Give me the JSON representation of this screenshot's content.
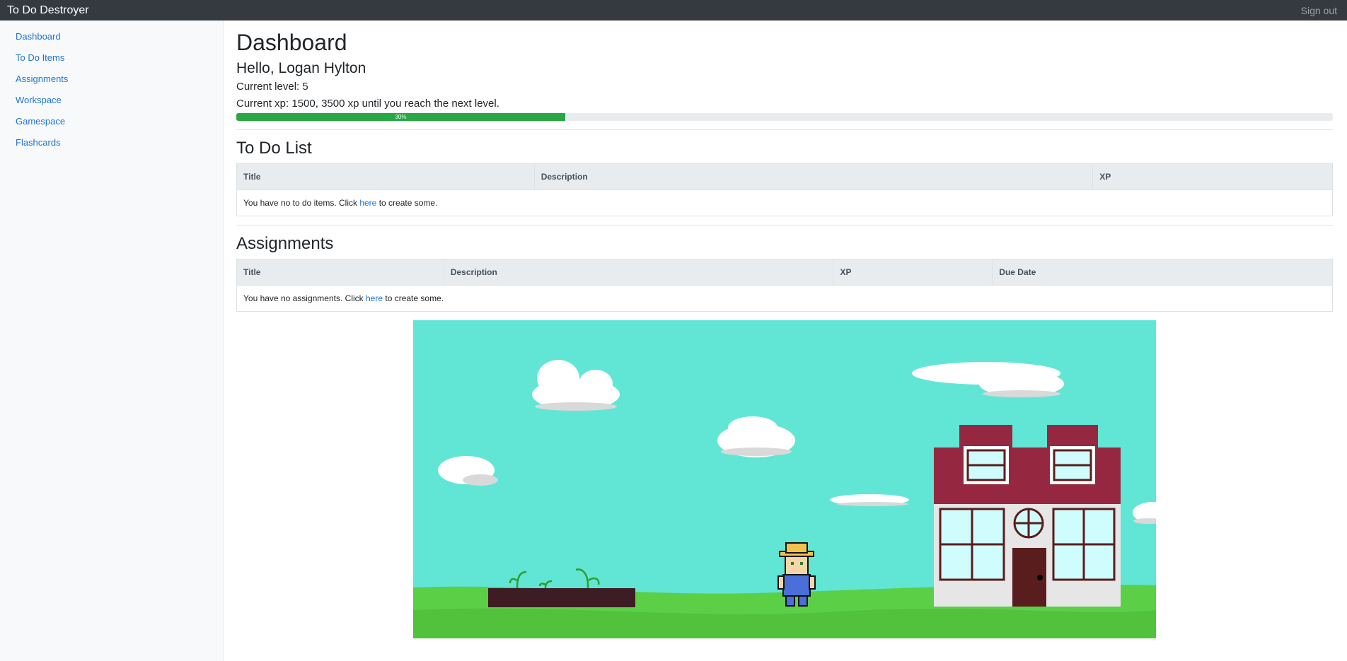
{
  "app": {
    "title": "To Do Destroyer",
    "signout_label": "Sign out"
  },
  "sidebar": {
    "items": [
      {
        "label": "Dashboard"
      },
      {
        "label": "To Do Items"
      },
      {
        "label": "Assignments"
      },
      {
        "label": "Workspace"
      },
      {
        "label": "Gamespace"
      },
      {
        "label": "Flashcards"
      }
    ]
  },
  "dashboard": {
    "title": "Dashboard",
    "greeting": "Hello, Logan Hylton",
    "level_text": "Current level: 5",
    "xp_text": "Current xp: 1500, 3500 xp until you reach the next level.",
    "progress": {
      "percent": 30,
      "label": "30%"
    }
  },
  "todo": {
    "heading": "To Do List",
    "columns": [
      "Title",
      "Description",
      "XP"
    ],
    "empty_before": "You have no to do items. Click ",
    "empty_link": "here",
    "empty_after": " to create some."
  },
  "assignments": {
    "heading": "Assignments",
    "columns": [
      "Title",
      "Description",
      "XP",
      "Due Date"
    ],
    "empty_before": "You have no assignments. Click ",
    "empty_link": "here",
    "empty_after": " to create some."
  },
  "colors": {
    "topbar": "#343a40",
    "link": "#1c75d6",
    "progress": "#28a745",
    "sky": "#61e6d6",
    "grass": "#5bcf46",
    "roof": "#952840"
  }
}
